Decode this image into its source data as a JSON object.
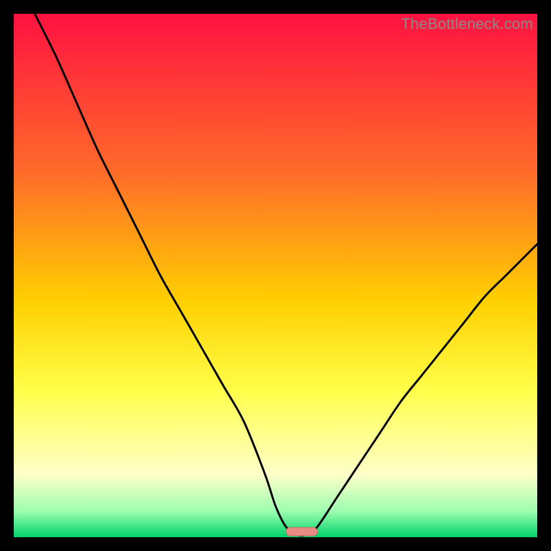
{
  "watermark": "TheBottleneck.com",
  "colors": {
    "black": "#000000",
    "curve": "#000000",
    "marker_fill": "#e98b84",
    "marker_stroke": "#d46a63",
    "grad_top": "#ff1240",
    "grad_mid1": "#ff6a2a",
    "grad_mid2": "#ffd000",
    "grad_mid3": "#ffff4a",
    "grad_pale": "#ffffc8",
    "grad_green_top": "#9dffb0",
    "grad_green": "#00d26a"
  },
  "chart_data": {
    "type": "line",
    "title": "",
    "xlabel": "",
    "ylabel": "",
    "xlim": [
      0,
      100
    ],
    "ylim": [
      0,
      100
    ],
    "series": [
      {
        "name": "bottleneck-curve",
        "x": [
          4,
          8,
          12,
          16,
          20,
          24,
          28,
          32,
          36,
          40,
          44,
          48,
          50,
          52,
          54,
          56,
          58,
          62,
          66,
          70,
          74,
          78,
          82,
          86,
          90,
          94,
          98,
          100
        ],
        "y": [
          100,
          92,
          83,
          74,
          66,
          58,
          50,
          43,
          36,
          29,
          22,
          12,
          6,
          2,
          0.5,
          0.5,
          2,
          8,
          14,
          20,
          26,
          31,
          36,
          41,
          46,
          50,
          54,
          56
        ]
      }
    ],
    "marker": {
      "x_center": 55,
      "width": 6,
      "height": 1.6
    },
    "annotations": []
  }
}
